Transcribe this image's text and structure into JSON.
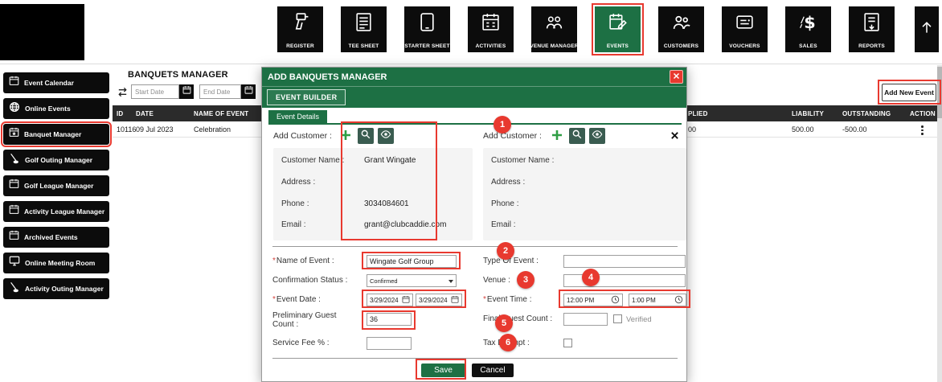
{
  "colors": {
    "green": "#1d7044",
    "annotation_red": "#e8392f",
    "toolbar_black": "#0c0c0c"
  },
  "toolbar": {
    "items": [
      {
        "label": "REGISTER",
        "icon": "register-icon",
        "active": false
      },
      {
        "label": "TEE SHEET",
        "icon": "tee-sheet-icon",
        "active": false
      },
      {
        "label": "STARTER SHEET",
        "icon": "starter-sheet-icon",
        "active": false
      },
      {
        "label": "ACTIVITIES",
        "icon": "activities-icon",
        "active": false
      },
      {
        "label": "VENUE MANAGER",
        "icon": "venue-manager-icon",
        "active": false
      },
      {
        "label": "EVENTS",
        "icon": "events-icon",
        "active": true
      },
      {
        "label": "CUSTOMERS",
        "icon": "customers-icon",
        "active": false
      },
      {
        "label": "VOUCHERS",
        "icon": "vouchers-icon",
        "active": false
      },
      {
        "label": "SALES",
        "icon": "sales-icon",
        "active": false
      },
      {
        "label": "REPORTS",
        "icon": "reports-icon",
        "active": false
      }
    ],
    "scroll_top_icon": "up-arrow-icon"
  },
  "sidebar": {
    "items": [
      {
        "label": "Event Calendar",
        "icon": "calendar-icon"
      },
      {
        "label": "Online Events",
        "icon": "globe-icon"
      },
      {
        "label": "Banquet Manager",
        "icon": "star-calendar-icon",
        "highlighted": true
      },
      {
        "label": "Golf Outing Manager",
        "icon": "golf-icon"
      },
      {
        "label": "Golf League Manager",
        "icon": "calendar-icon"
      },
      {
        "label": "Activity League Manager",
        "icon": "calendar-icon"
      },
      {
        "label": "Archived Events",
        "icon": "calendar-icon"
      },
      {
        "label": "Online Meeting Room",
        "icon": "monitor-icon"
      },
      {
        "label": "Activity Outing Manager",
        "icon": "golf-icon"
      }
    ]
  },
  "main": {
    "title": "BANQUETS MANAGER",
    "filters": {
      "start_date_placeholder": "Start Date",
      "end_date_placeholder": "End Date"
    },
    "add_new_event_label": "Add New Event",
    "table": {
      "headers": {
        "id": "ID",
        "date": "DATE",
        "name": "NAME OF EVENT",
        "applied": "PLIED",
        "liability": "LIABILITY",
        "outstanding": "OUTSTANDING",
        "action": "ACTION"
      },
      "row": {
        "id": "10116",
        "date": "09 Jul 2023",
        "name": "Celebration",
        "applied": "00",
        "liability": "500.00",
        "outstanding": "-500.00",
        "action_icon": "kebab-menu-icon"
      }
    }
  },
  "modal": {
    "title": "ADD BANQUETS MANAGER",
    "tab_label": "EVENT BUILDER",
    "section_label": "Event Details",
    "customer_left": {
      "add_label": "Add Customer :",
      "name_label": "Customer Name :",
      "name_value": "Grant Wingate",
      "address_label": "Address :",
      "address_value": "",
      "phone_label": "Phone :",
      "phone_value": "3034084601",
      "email_label": "Email :",
      "email_value": "grant@clubcaddie.com"
    },
    "customer_right": {
      "add_label": "Add Customer :",
      "name_label": "Customer Name :",
      "name_value": "",
      "address_label": "Address :",
      "address_value": "",
      "phone_label": "Phone :",
      "phone_value": "",
      "email_label": "Email :",
      "email_value": ""
    },
    "fields": {
      "name_of_event": {
        "required": "*",
        "label": "Name of Event :",
        "value": "Wingate Golf Group"
      },
      "type_of_event": {
        "label": "Type Of Event :",
        "value": ""
      },
      "confirmation_status": {
        "label": "Confirmation Status :",
        "value": "Confirmed"
      },
      "venue": {
        "label": "Venue :",
        "value": ""
      },
      "event_date": {
        "required": "*",
        "label": "Event Date :",
        "start": "3/29/2024",
        "end": "3/29/2024"
      },
      "event_time": {
        "required": "*",
        "label": "Event Time :",
        "start": "12:00 PM",
        "end": "1:00 PM"
      },
      "preliminary_guest_count": {
        "label": "Preliminary Guest Count :",
        "value": "36"
      },
      "final_guest_count": {
        "label": "Final Guest Count :",
        "value": "",
        "verified_label": "Verified"
      },
      "service_fee": {
        "label": "Service Fee % :",
        "value": ""
      },
      "tax_exempt": {
        "label": "Tax Exempt :"
      }
    },
    "buttons": {
      "save": "Save",
      "cancel": "Cancel"
    }
  },
  "annotations": {
    "steps": [
      "1",
      "2",
      "3",
      "4",
      "5",
      "6"
    ]
  }
}
